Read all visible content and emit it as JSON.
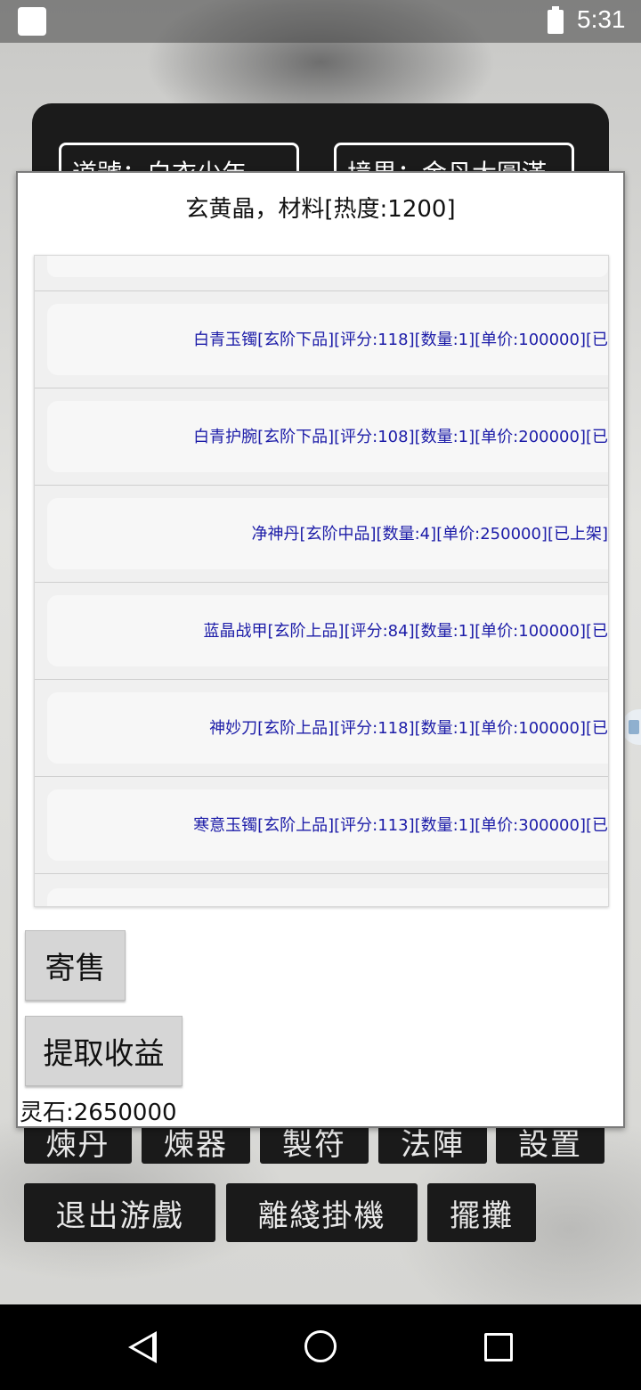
{
  "status_bar": {
    "time": "5:31"
  },
  "header": {
    "name_text": "道號：白衣少年",
    "realm_text": "境界：金丹大圓滿"
  },
  "game_menu": {
    "row1": [
      "煉丹",
      "煉器",
      "製符",
      "法陣",
      "設置"
    ],
    "row2": [
      "退出游戲",
      "離綫掛機",
      "擺攤"
    ]
  },
  "dialog": {
    "title": "玄黄晶，材料[热度:1200]",
    "items": [
      "白青玉镯[玄阶下品][评分:118][数量:1][单价:100000][已",
      "白青护腕[玄阶下品][评分:108][数量:1][单价:200000][已",
      "净神丹[玄阶中品][数量:4][单价:250000][已上架]",
      "蓝晶战甲[玄阶上品][评分:84][数量:1][单价:100000][已",
      "神妙刀[玄阶上品][评分:118][数量:1][单价:100000][已",
      "寒意玉镯[玄阶上品][评分:113][数量:1][单价:300000][已"
    ],
    "sell_label": "寄售",
    "withdraw_label": "提取收益",
    "balance": "灵石:2650000"
  },
  "icons": {
    "nav_back": "back-triangle-icon",
    "nav_home": "home-circle-icon",
    "nav_recent": "recents-square-icon"
  }
}
